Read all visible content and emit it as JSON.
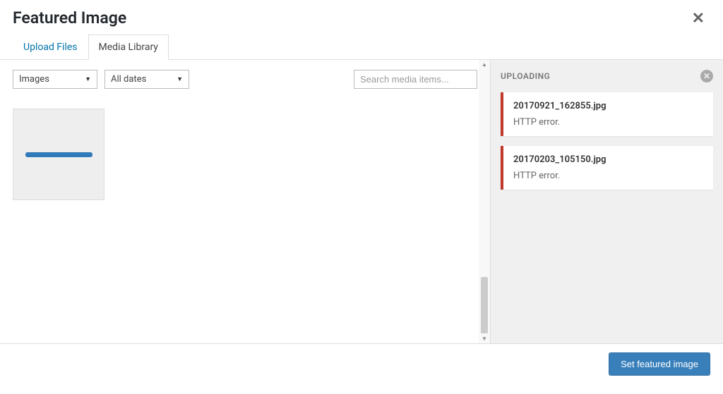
{
  "modal": {
    "title": "Featured Image"
  },
  "tabs": {
    "upload_files": "Upload Files",
    "media_library": "Media Library"
  },
  "filters": {
    "type_selected": "Images",
    "date_selected": "All dates"
  },
  "search": {
    "placeholder": "Search media items..."
  },
  "sidebar": {
    "title": "UPLOADING",
    "uploads": [
      {
        "filename": "20170921_162855.jpg",
        "error": "HTTP error."
      },
      {
        "filename": "20170203_105150.jpg",
        "error": "HTTP error."
      }
    ]
  },
  "footer": {
    "primary_button": "Set featured image"
  }
}
